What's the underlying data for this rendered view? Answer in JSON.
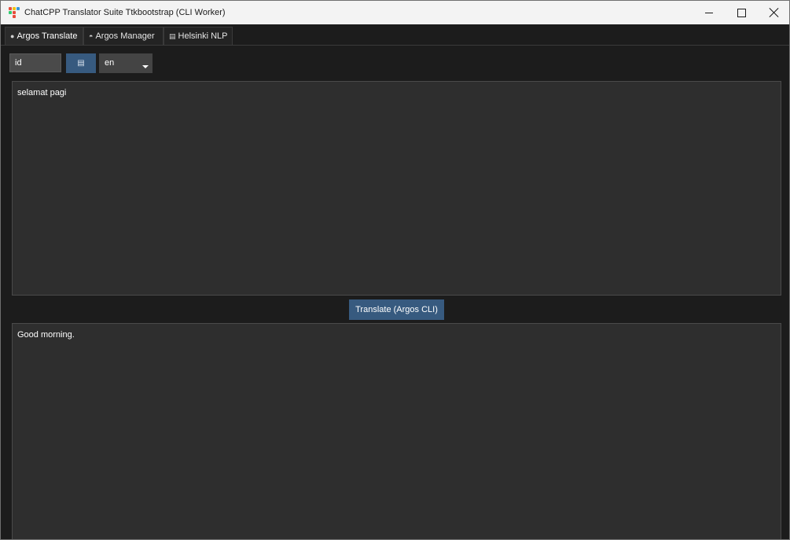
{
  "window": {
    "title": "ChatCPP Translator Suite Ttkbootstrap (CLI Worker)",
    "icon": "app-logo-dots",
    "controls": {
      "minimize_icon": "minimize-icon",
      "maximize_icon": "maximize-icon",
      "close_icon": "close-icon"
    }
  },
  "tabs": [
    {
      "label": "Argos Translate",
      "icon": "globe-icon",
      "active": true
    },
    {
      "label": "Argos Manager",
      "icon": "package-icon",
      "active": false
    },
    {
      "label": "Helsinki NLP",
      "icon": "book-icon",
      "active": false
    }
  ],
  "controls": {
    "source_language": "id",
    "swap_button_icon": "swap-icon",
    "target_language": "en"
  },
  "input_text": "selamat pagi",
  "translate_button": "Translate (Argos CLI)",
  "output_text": "Good morning.",
  "colors": {
    "background": "#1c1c1c",
    "textbox": "#2e2e2e",
    "primary_button": "#375a7f"
  }
}
